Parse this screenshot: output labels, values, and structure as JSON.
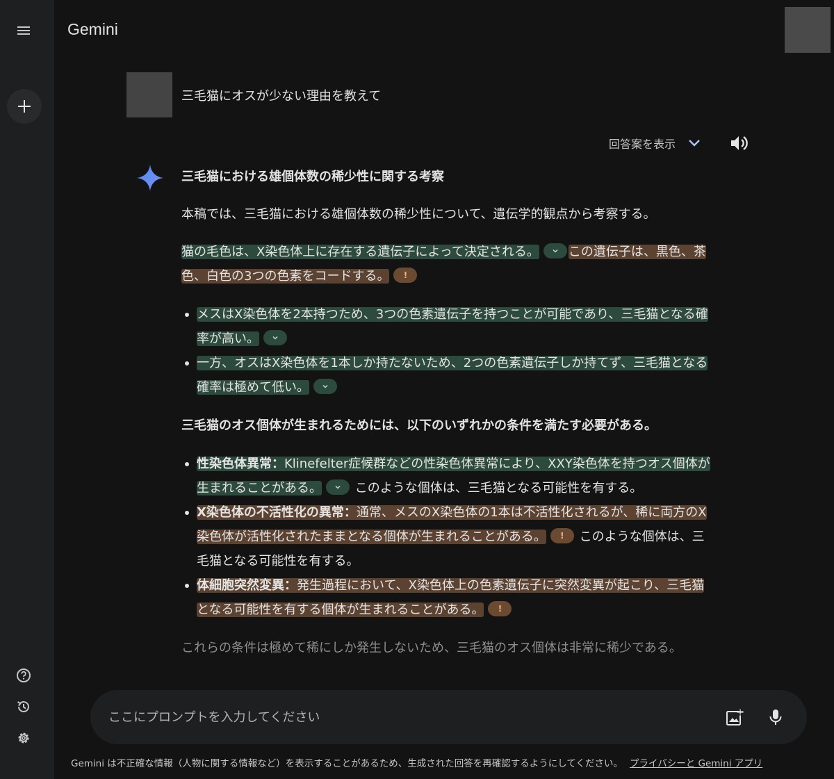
{
  "app": {
    "title": "Gemini"
  },
  "sidebar": {
    "menu_icon": "hamburger-menu-icon",
    "new_chat_icon": "plus-icon",
    "bottom_icons": [
      "help-icon",
      "history-icon",
      "settings-icon"
    ]
  },
  "conversation": {
    "user_prompt": "三毛猫にオスが少ない理由を教えて",
    "drafts_label": "回答案を表示",
    "answer": {
      "title": "三毛猫における雄個体数の稀少性に関する考察",
      "intro": "本稿では、三毛猫における雄個体数の稀少性について、遺伝学的観点から考察する。",
      "para1_green": "猫の毛色は、X染色体上に存在する遺伝子によって決定される。",
      "para1_brown": "この遺伝子は、黒色、茶色、白色の3つの色素をコードする。",
      "bullets1": [
        "メスはX染色体を2本持つため、3つの色素遺伝子を持つことが可能であり、三毛猫となる確率が高い。",
        "一方、オスはX染色体を1本しか持たないため、2つの色素遺伝子しか持てず、三毛猫となる確率は極めて低い。"
      ],
      "section_heading": "三毛猫のオス個体が生まれるためには、以下のいずれかの条件を満たす必要がある。",
      "conditions": [
        {
          "term": "性染色体異常：",
          "text": "Klinefelter症候群などの性染色体異常により、XXY染色体を持つオス個体が生まれることがある。",
          "after": "このような個体は、三毛猫となる可能性を有する。"
        },
        {
          "term": "X染色体の不活性化の異常：",
          "text": "通常、メスのX染色体の1本は不活性化されるが、稀に両方のX染色体が活性化されたままとなる個体が生まれることがある。",
          "after": "このような個体は、三毛猫となる可能性を有する。"
        },
        {
          "term": "体細胞突然変異：",
          "text": "発生過程において、X染色体上の色素遺伝子に突然変異が起こり、三毛猫となる可能性を有する個体が生まれることがある。",
          "after": ""
        }
      ],
      "conclusion": "これらの条件は極めて稀にしか発生しないため、三毛猫のオス個体は非常に稀少である。"
    },
    "highlight_colors": {
      "verified": "#2d4a3e",
      "unverified": "#5b4231"
    }
  },
  "input": {
    "placeholder": "ここにプロンプトを入力してください",
    "image_icon": "add-image-icon",
    "mic_icon": "microphone-icon"
  },
  "footer": {
    "disclaimer": "Gemini は不正確な情報（人物に関する情報など）を表示することがあるため、生成された回答を再確認するようにしてください。",
    "link": "プライバシーと Gemini アプリ"
  }
}
